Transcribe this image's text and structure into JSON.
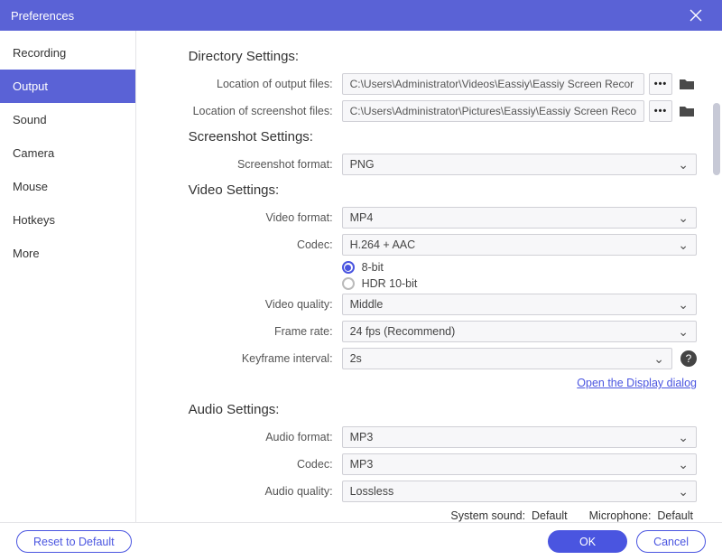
{
  "colors": {
    "accent": "#5a62d6"
  },
  "window": {
    "title": "Preferences"
  },
  "sidebar": {
    "items": [
      {
        "label": "Recording"
      },
      {
        "label": "Output"
      },
      {
        "label": "Sound"
      },
      {
        "label": "Camera"
      },
      {
        "label": "Mouse"
      },
      {
        "label": "Hotkeys"
      },
      {
        "label": "More"
      }
    ],
    "active_index": 1
  },
  "sections": {
    "directory": {
      "title": "Directory Settings:",
      "output_label": "Location of output files:",
      "output_path": "C:\\Users\\Administrator\\Videos\\Eassiy\\Eassiy Screen Recor",
      "screenshot_label": "Location of screenshot files:",
      "screenshot_path": "C:\\Users\\Administrator\\Pictures\\Eassiy\\Eassiy Screen Reco"
    },
    "screenshot": {
      "title": "Screenshot Settings:",
      "format_label": "Screenshot format:",
      "format_value": "PNG"
    },
    "video": {
      "title": "Video Settings:",
      "format_label": "Video format:",
      "format_value": "MP4",
      "codec_label": "Codec:",
      "codec_value": "H.264 + AAC",
      "bit_depth": {
        "eight": "8-bit",
        "hdr": "HDR 10-bit",
        "selected": "eight"
      },
      "quality_label": "Video quality:",
      "quality_value": "Middle",
      "framerate_label": "Frame rate:",
      "framerate_value": "24 fps (Recommend)",
      "keyframe_label": "Keyframe interval:",
      "keyframe_value": "2s",
      "display_link": "Open the Display dialog"
    },
    "audio": {
      "title": "Audio Settings:",
      "format_label": "Audio format:",
      "format_value": "MP3",
      "codec_label": "Codec:",
      "codec_value": "MP3",
      "quality_label": "Audio quality:",
      "quality_value": "Lossless"
    }
  },
  "status": {
    "system_sound_label": "System sound:",
    "system_sound_value": "Default",
    "microphone_label": "Microphone:",
    "microphone_value": "Default"
  },
  "footer": {
    "reset": "Reset to Default",
    "ok": "OK",
    "cancel": "Cancel"
  }
}
